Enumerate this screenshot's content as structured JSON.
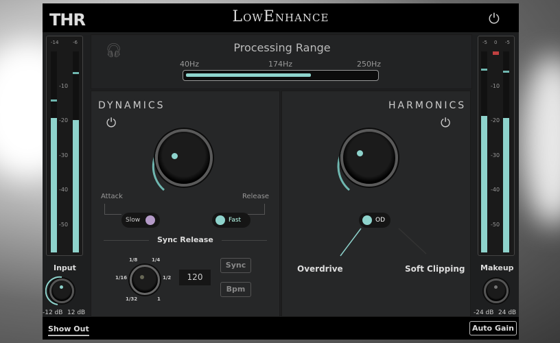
{
  "header": {
    "logo": "THR",
    "title": "LowEnhance"
  },
  "range": {
    "title": "Processing Range",
    "low": "40Hz",
    "mid": "174Hz",
    "high": "250Hz",
    "fill_fraction": 0.66
  },
  "input_meter": {
    "top_labels": [
      "-14",
      "-6"
    ],
    "scale": [
      "-10",
      "-20",
      "-30",
      "-40",
      "-50"
    ],
    "fill_left": 0.67,
    "fill_right": 0.66
  },
  "output_meter": {
    "top_labels": [
      "-5",
      "0",
      "-5"
    ],
    "scale": [
      "-10",
      "-20",
      "-30",
      "-40",
      "-50"
    ],
    "fill_left": 0.68,
    "fill_right": 0.67
  },
  "input": {
    "label": "Input",
    "min": "-12 dB",
    "max": "12 dB"
  },
  "makeup": {
    "label": "Makeup",
    "min": "-24 dB",
    "max": "24 dB"
  },
  "dynamics": {
    "title": "DYNAMICS",
    "attack_label": "Attack",
    "release_label": "Release",
    "attack_value": "Slow",
    "release_value": "Fast",
    "sync_title": "Sync Release",
    "divisions": [
      "1/8",
      "1/4",
      "1/16",
      "1/2",
      "1/32",
      "1"
    ],
    "bpm": "120",
    "sync_button": "Sync",
    "bpm_button": "Bpm"
  },
  "harmonics": {
    "title": "HARMONICS",
    "mode": "OD",
    "overdrive": "Overdrive",
    "soft_clipping": "Soft Clipping"
  },
  "footer": {
    "show_out": "Show Out",
    "auto_gain": "Auto Gain"
  },
  "colors": {
    "accent": "#8ed3cc",
    "attack_dot": "#b49ac8",
    "clip": "#c04040"
  }
}
